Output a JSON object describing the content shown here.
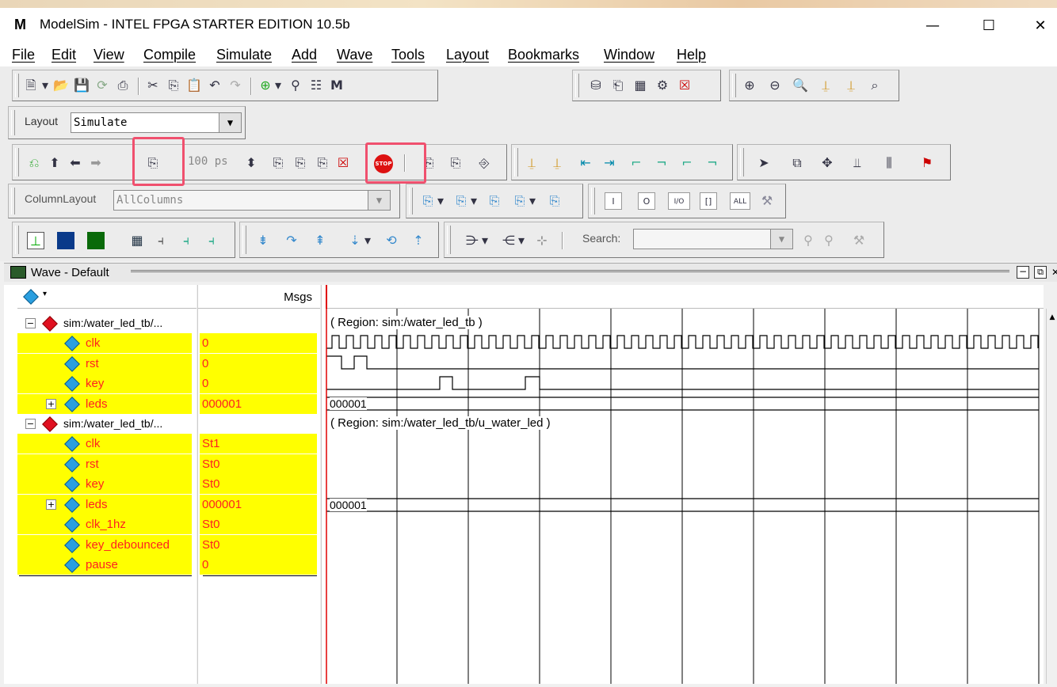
{
  "window": {
    "title": "ModelSim - INTEL FPGA STARTER EDITION 10.5b",
    "logo": "M",
    "minimize": "—",
    "maximize": "☐",
    "close": "✕"
  },
  "menu": [
    "File",
    "Edit",
    "View",
    "Compile",
    "Simulate",
    "Add",
    "Wave",
    "Tools",
    "Layout",
    "Bookmarks",
    "Window",
    "Help"
  ],
  "toolbar": {
    "layout_label": "Layout",
    "layout_value": "Simulate",
    "run_length": "100 ps",
    "column_layout_label": "ColumnLayout",
    "column_layout_value": "AllColumns",
    "search_label": "Search:",
    "search_value": "",
    "stop_label": "STOP"
  },
  "wave_window": {
    "title": "Wave - Default",
    "msgs_header": "Msgs",
    "groups": [
      {
        "path": "sim:/water_led_tb/...",
        "region": "( Region: sim:/water_led_tb )",
        "signals": [
          {
            "name": "clk",
            "value": "0"
          },
          {
            "name": "rst",
            "value": "0"
          },
          {
            "name": "key",
            "value": "0"
          },
          {
            "name": "leds",
            "value": "000001",
            "bus": true,
            "bus_text": "000001"
          }
        ]
      },
      {
        "path": "sim:/water_led_tb/...",
        "region": "( Region: sim:/water_led_tb/u_water_led )",
        "signals": [
          {
            "name": "clk",
            "value": "St1"
          },
          {
            "name": "rst",
            "value": "St0"
          },
          {
            "name": "key",
            "value": "St0"
          },
          {
            "name": "leds",
            "value": "000001",
            "bus": true,
            "bus_text": "000001"
          },
          {
            "name": "clk_1hz",
            "value": "St0"
          },
          {
            "name": "key_debounced",
            "value": "St0"
          },
          {
            "name": "pause",
            "value": "0"
          }
        ]
      }
    ]
  },
  "colors": {
    "signal_bg": "#ffff00",
    "signal_text": "#ff2020",
    "cursor": "#e00000",
    "highlight": "#f0506e"
  }
}
